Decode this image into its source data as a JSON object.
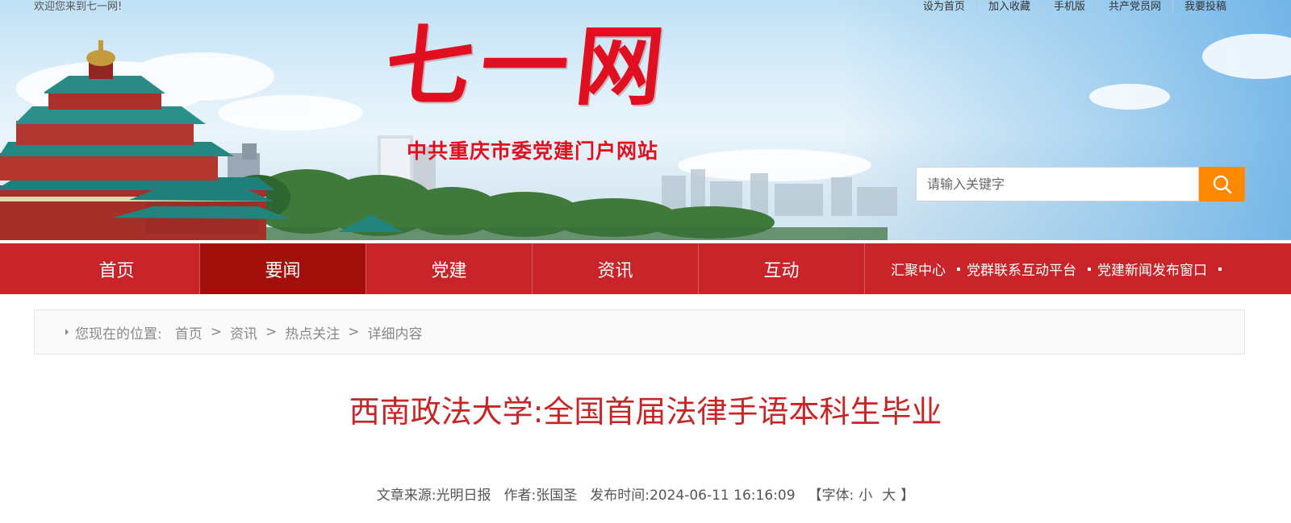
{
  "topbar": {
    "welcome": "欢迎您来到七一网!",
    "links": [
      "设为首页",
      "加入收藏",
      "手机版",
      "共产党员网",
      "我要投稿"
    ]
  },
  "logo": {
    "title": "七一网",
    "subtitle": "中共重庆市委党建门户网站"
  },
  "search": {
    "placeholder": "请输入关键字",
    "button_icon": "search-icon",
    "button_color": "#ff8a00"
  },
  "nav": {
    "items": [
      {
        "label": "首页",
        "active": false
      },
      {
        "label": "要闻",
        "active": true
      },
      {
        "label": "党建",
        "active": false
      },
      {
        "label": "资讯",
        "active": false
      },
      {
        "label": "互动",
        "active": false
      }
    ],
    "quick_links": [
      "汇聚中心",
      "党群联系互动平台",
      "党建新闻发布窗口"
    ],
    "bg_color": "#c8242a",
    "active_color": "#a3100c"
  },
  "breadcrumb": {
    "lead": "您现在的位置:",
    "items": [
      "首页",
      "资讯",
      "热点关注",
      "详细内容"
    ],
    "separator": ">"
  },
  "article": {
    "title": "西南政法大学:全国首届法律手语本科生毕业",
    "title_color": "#c62626",
    "source_label": "文章来源:",
    "source": "光明日报",
    "author_label": "作者:",
    "author": "张国圣",
    "time_label": "发布时间:",
    "time": "2024-06-11 16:16:09",
    "font_open": "【",
    "font_label": "字体:",
    "font_small": "小",
    "font_large": "大",
    "font_close": "】"
  }
}
